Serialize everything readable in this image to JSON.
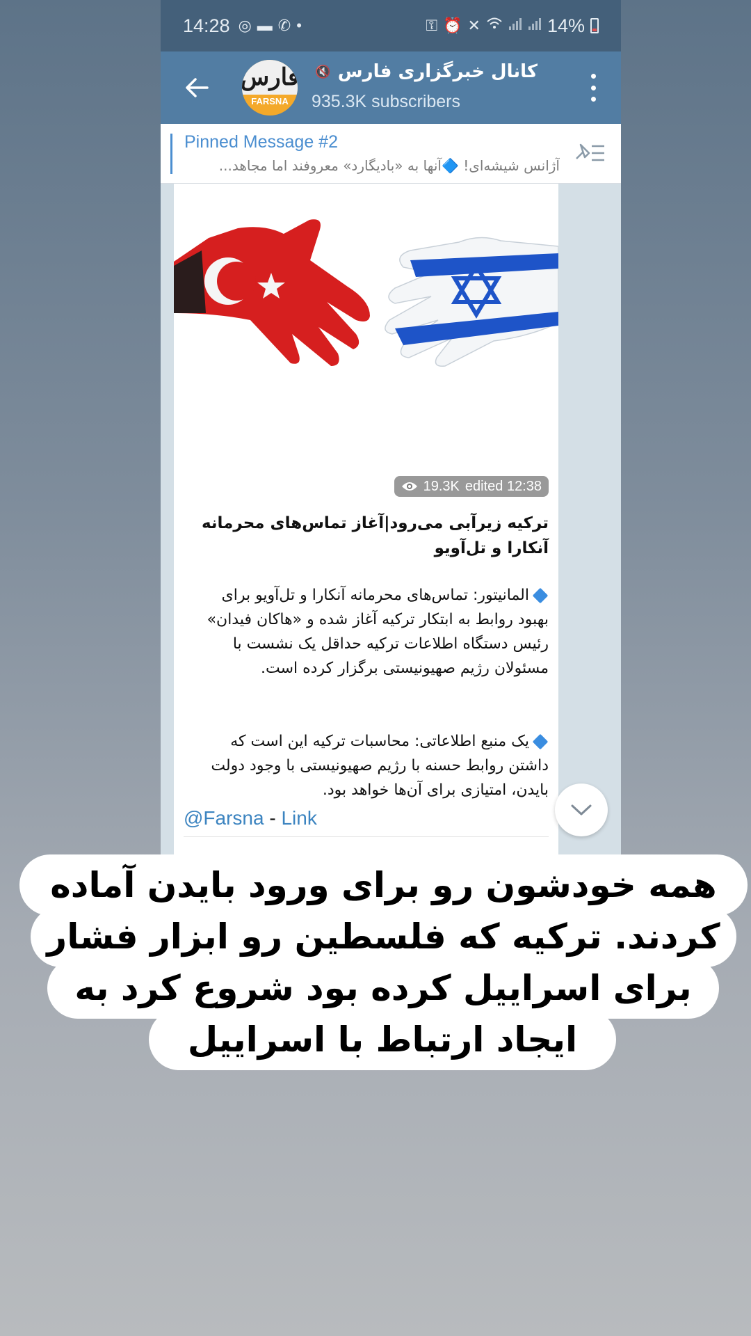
{
  "status_bar": {
    "time": "14:28",
    "battery": "14%",
    "left_icons": [
      "sync-icon",
      "message-icon",
      "whatsapp-icon",
      "dot-icon"
    ],
    "right_icons": [
      "key-icon",
      "alarm-icon",
      "mute-icon",
      "wifi-icon",
      "signal-icon",
      "signal-icon"
    ]
  },
  "header": {
    "channel_name": "کانال خبرگزاری فارس",
    "subscribers": "935.3K subscribers",
    "avatar_logo_text": "فارس",
    "avatar_logo_sub": "FARSNA",
    "header_color": "#527da3"
  },
  "pinned": {
    "title": "Pinned Message #2",
    "preview": "آژانس شیشه‌ای! 🔷آنها به «بادیگارد» معروفند اما مجاهد..."
  },
  "message": {
    "views": "19.3K",
    "edited": "edited 12:38",
    "title": "ترکیه زیرآبی می‌رود|آغاز تماس‌های محرمانه آنکارا و تل‌آویو",
    "paragraph1": "المانیتور: تماس‌های محرمانه آنکارا و تل‌آویو برای بهبود روابط به ابتکار ترکیه آغاز شده و «هاکان فیدان» رئیس دستگاه اطلاعات ترکیه حداقل یک نشست با مسئولان رژیم صهیونیستی برگزار کرده است.",
    "paragraph2": "یک منبع اطلاعاتی: محاسبات ترکیه این است که داشتن روابط حسنه با رژیم صهیونیستی با وجود دولت بایدن، امتیازی برای آن‌ها خواهد بود.",
    "link_handle": "@Farsna",
    "link_separator": " - ",
    "link_text": "Link",
    "link_color": "#3c84c0"
  },
  "caption": {
    "line1": "همه خودشون رو برای ورود بایدن آماده",
    "line2": "کردند. ترکیه که فلسطین رو ابزار فشار",
    "line3": "برای اسراییل کرده بود شروع کرد به",
    "line4": "ایجاد ارتباط با اسراییل"
  }
}
